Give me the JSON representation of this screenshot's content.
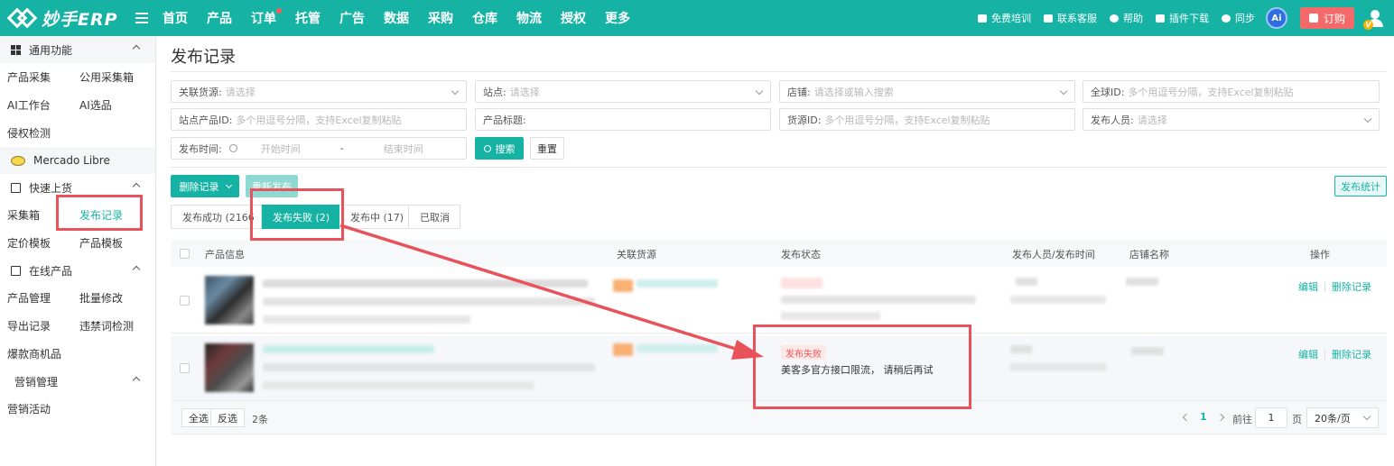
{
  "app": {
    "logo_text": "妙手ERP"
  },
  "nav": [
    "首页",
    "产品",
    "订单",
    "托管",
    "广告",
    "数据",
    "采购",
    "仓库",
    "物流",
    "授权",
    "更多"
  ],
  "top_right": {
    "training": "免费培训",
    "support": "联系客服",
    "help": "帮助",
    "plugin": "插件下载",
    "sync": "同步",
    "ai": "Ai",
    "order": "订购",
    "vip": "V"
  },
  "sidebar": {
    "general_title": "通用功能",
    "general_items": [
      "产品采集",
      "公用采集箱",
      "AI工作台",
      "AI选品",
      "侵权检测"
    ],
    "platform": "Mercado Libre",
    "quick_title": "快速上货",
    "quick_items": [
      "采集箱",
      "发布记录",
      "定价模板",
      "产品模板"
    ],
    "online_title": "在线产品",
    "online_items": [
      "产品管理",
      "批量修改",
      "导出记录",
      "违禁词检测",
      "爆款商机品"
    ],
    "marketing_title": "营销管理",
    "marketing_items": [
      "营销活动"
    ]
  },
  "page": {
    "title": "发布记录"
  },
  "filters": {
    "source": {
      "label": "关联货源:",
      "placeholder": "请选择"
    },
    "site": {
      "label": "站点:",
      "placeholder": "请选择"
    },
    "store": {
      "label": "店铺:",
      "placeholder": "请选择或输入搜索"
    },
    "global_id": {
      "label": "全球ID:",
      "placeholder": "多个用逗号分隔，支持Excel复制粘贴"
    },
    "site_product_id": {
      "label": "站点产品ID:",
      "placeholder": "多个用逗号分隔，支持Excel复制粘贴"
    },
    "product_title": {
      "label": "产品标题:",
      "placeholder": ""
    },
    "source_id": {
      "label": "货源ID:",
      "placeholder": "多个用逗号分隔，支持Excel复制粘贴"
    },
    "publisher": {
      "label": "发布人员:",
      "placeholder": "请选择"
    },
    "publish_time": {
      "label": "发布时间:",
      "start": "开始时间",
      "separator": "-",
      "end": "结束时间"
    },
    "search_button": "搜索",
    "reset_button": "重置"
  },
  "actions": {
    "delete_records": "删除记录",
    "republish": "重新发布",
    "stats": "发布统计"
  },
  "tabs": [
    {
      "label": "发布成功 (2166",
      "active": false
    },
    {
      "label": "发布失败 (2)",
      "active": true
    },
    {
      "label": "发布中 (17)",
      "active": false
    },
    {
      "label": "已取消",
      "active": false
    }
  ],
  "table": {
    "headers": [
      "产品信息",
      "关联货源",
      "发布状态",
      "发布人员/发布时间",
      "店铺名称",
      "操作"
    ],
    "rows": [
      {
        "status_tag": "",
        "status_msg": "",
        "edit": "编辑",
        "delete": "删除记录"
      },
      {
        "status_tag": "发布失败",
        "status_msg": "美客多官方接口限流， 请稍后再试",
        "edit": "编辑",
        "delete": "删除记录"
      }
    ]
  },
  "footer": {
    "select_all": "全选",
    "invert": "反选",
    "count": "2条",
    "current_page": "1",
    "goto": "前往",
    "page_input": "1",
    "page_unit": "页",
    "page_size": "20条/页"
  },
  "colors": {
    "brand": "#16b3a5",
    "annotation": "#e8525a",
    "error": "#f05656"
  }
}
